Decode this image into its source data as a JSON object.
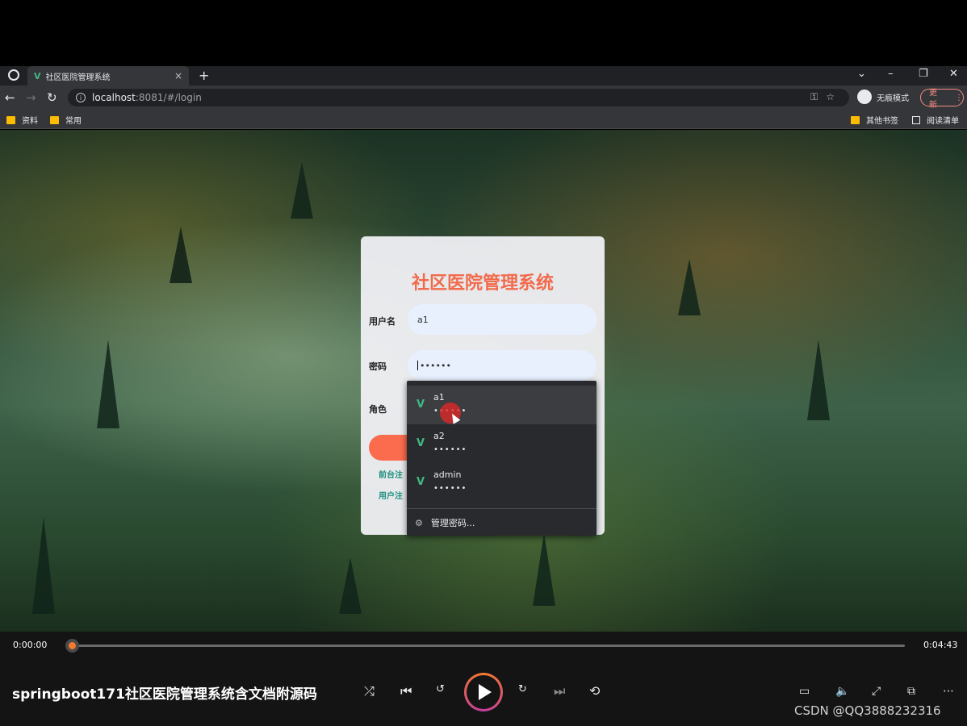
{
  "browser": {
    "tab_title": "社区医院管理系统",
    "tab_close": "×",
    "new_tab": "+",
    "url_host": "localhost",
    "url_rest": ":8081/#/login",
    "incognito_label": "无痕模式",
    "update_label": "更新",
    "bookmarks": [
      "资料",
      "常用"
    ],
    "bookmarks_right": [
      "其他书签",
      "阅读清单"
    ]
  },
  "login": {
    "title": "社区医院管理系统",
    "username_label": "用户名",
    "username_value": "a1",
    "password_label": "密码",
    "password_value": "••••••",
    "role_label": "角色",
    "link_front": "前台注",
    "link_user": "用户注"
  },
  "autofill": {
    "items": [
      {
        "user": "a1",
        "pw": "••••••"
      },
      {
        "user": "a2",
        "pw": "••••••"
      },
      {
        "user": "admin",
        "pw": "••••••"
      }
    ],
    "manage_label": "管理密码..."
  },
  "player": {
    "current_time": "0:00:00",
    "total_time": "0:04:43",
    "progress": 0.0,
    "title": "springboot171社区医院管理系统含文档附源码",
    "watermark": "CSDN @QQ3888232316"
  }
}
